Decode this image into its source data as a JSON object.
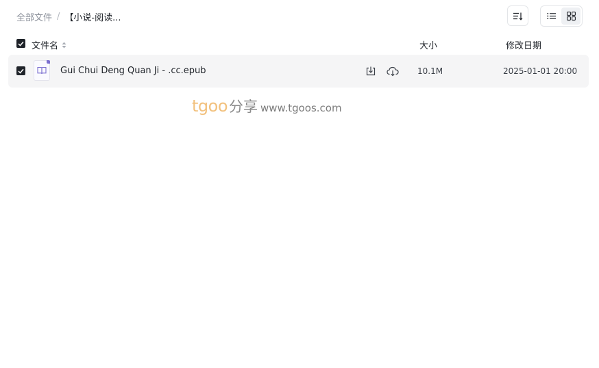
{
  "breadcrumb": {
    "root": "全部文件",
    "separator": "/",
    "current": "【小说-阅读..."
  },
  "toolbar": {
    "sort_icon": "sort-desc-icon",
    "view_list_icon": "list-view-icon",
    "view_grid_icon": "grid-view-icon",
    "active_view": "grid"
  },
  "columns": {
    "name": "文件名",
    "size": "大小",
    "date": "修改日期"
  },
  "files": [
    {
      "name": "Gui Chui Deng Quan Ji - .cc.epub",
      "size": "10.1M",
      "modified": "2025-01-01 20:00",
      "icon": "epub-book-icon",
      "selected": true
    }
  ],
  "watermark": {
    "brand": "tgoo",
    "share": "分享",
    "url": "www.tgoos.com"
  },
  "colors": {
    "accent_dark": "#1f2329",
    "row_bg": "#f5f5f6",
    "watermark_orange": "#f2c17e",
    "icon_purple": "#7b6fd0"
  }
}
